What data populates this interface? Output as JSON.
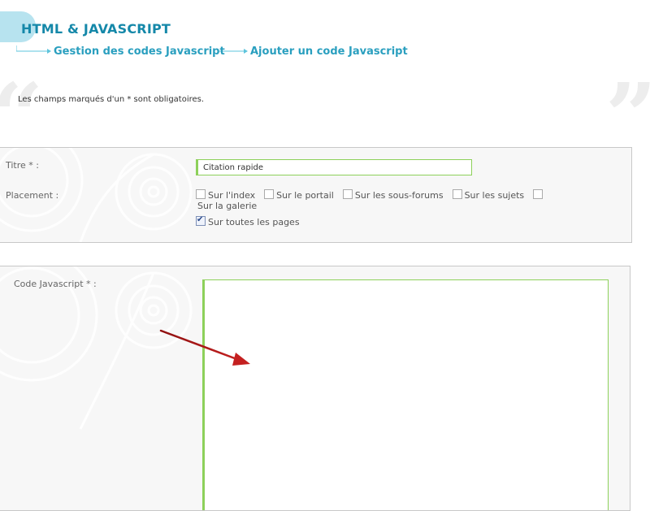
{
  "header": {
    "title": "HTML & JAVASCRIPT",
    "breadcrumb": [
      {
        "label": "Gestion des codes Javascript"
      },
      {
        "label": "Ajouter un code Javascript"
      }
    ]
  },
  "intro": "Les champs marqués d'un * sont obligatoires.",
  "form": {
    "titre_label": "Titre * :",
    "titre_value": "Citation rapide",
    "placement_label": "Placement :",
    "placement_options": [
      {
        "label": "Sur l'index",
        "checked": false
      },
      {
        "label": "Sur le portail",
        "checked": false
      },
      {
        "label": "Sur les sous-forums",
        "checked": false
      },
      {
        "label": "Sur les sujets",
        "checked": false
      },
      {
        "label": "Sur la galerie",
        "checked": false
      },
      {
        "label": "Sur toutes les pages",
        "checked": true
      }
    ],
    "code_label": "Code Javascript * :",
    "code_value": ""
  },
  "colors": {
    "accent": "#1588a9",
    "field_border": "#8dd05a",
    "bubble": "#b7e3ef",
    "annotation_arrow": "#b41e1e"
  }
}
